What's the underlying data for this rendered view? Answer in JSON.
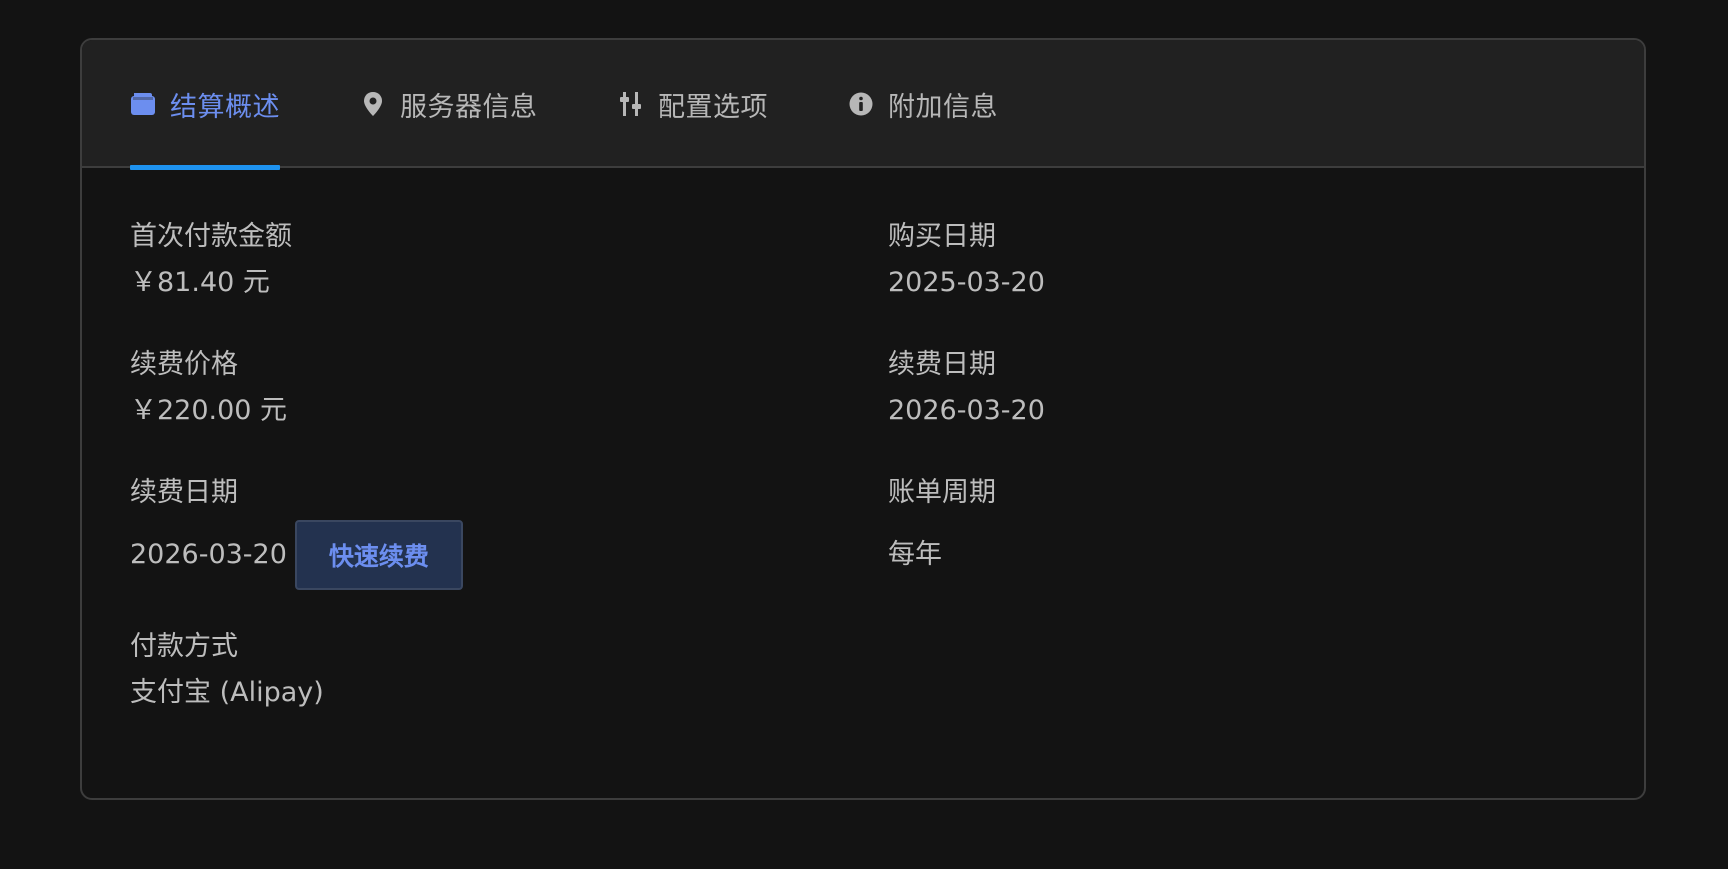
{
  "tabs": [
    {
      "label": "结算概述",
      "icon": "wallet-icon"
    },
    {
      "label": "服务器信息",
      "icon": "map-pin-icon"
    },
    {
      "label": "配置选项",
      "icon": "sliders-icon"
    },
    {
      "label": "附加信息",
      "icon": "info-circle-icon"
    }
  ],
  "active_tab": "结算概述",
  "billing": {
    "first_payment_label": "首次付款金额",
    "first_payment_value": "￥81.40 元",
    "purchase_date_label": "购买日期",
    "purchase_date_value": "2025-03-20",
    "renewal_price_label": "续费价格",
    "renewal_price_value": "￥220.00 元",
    "renewal_date_label": "续费日期",
    "renewal_date_value": "2026-03-20",
    "next_due_label": "续费日期",
    "next_due_value": "2026-03-20",
    "quick_renew_label": "快速续费",
    "billing_cycle_label": "账单周期",
    "billing_cycle_value": "每年",
    "payment_method_label": "付款方式",
    "payment_method_value": "支付宝 (Alipay)"
  },
  "colors": {
    "accent": "#6c8eef",
    "underline": "#1e93f0",
    "background": "#131313",
    "tabbar": "#212121",
    "text": "#bdbdbd"
  }
}
